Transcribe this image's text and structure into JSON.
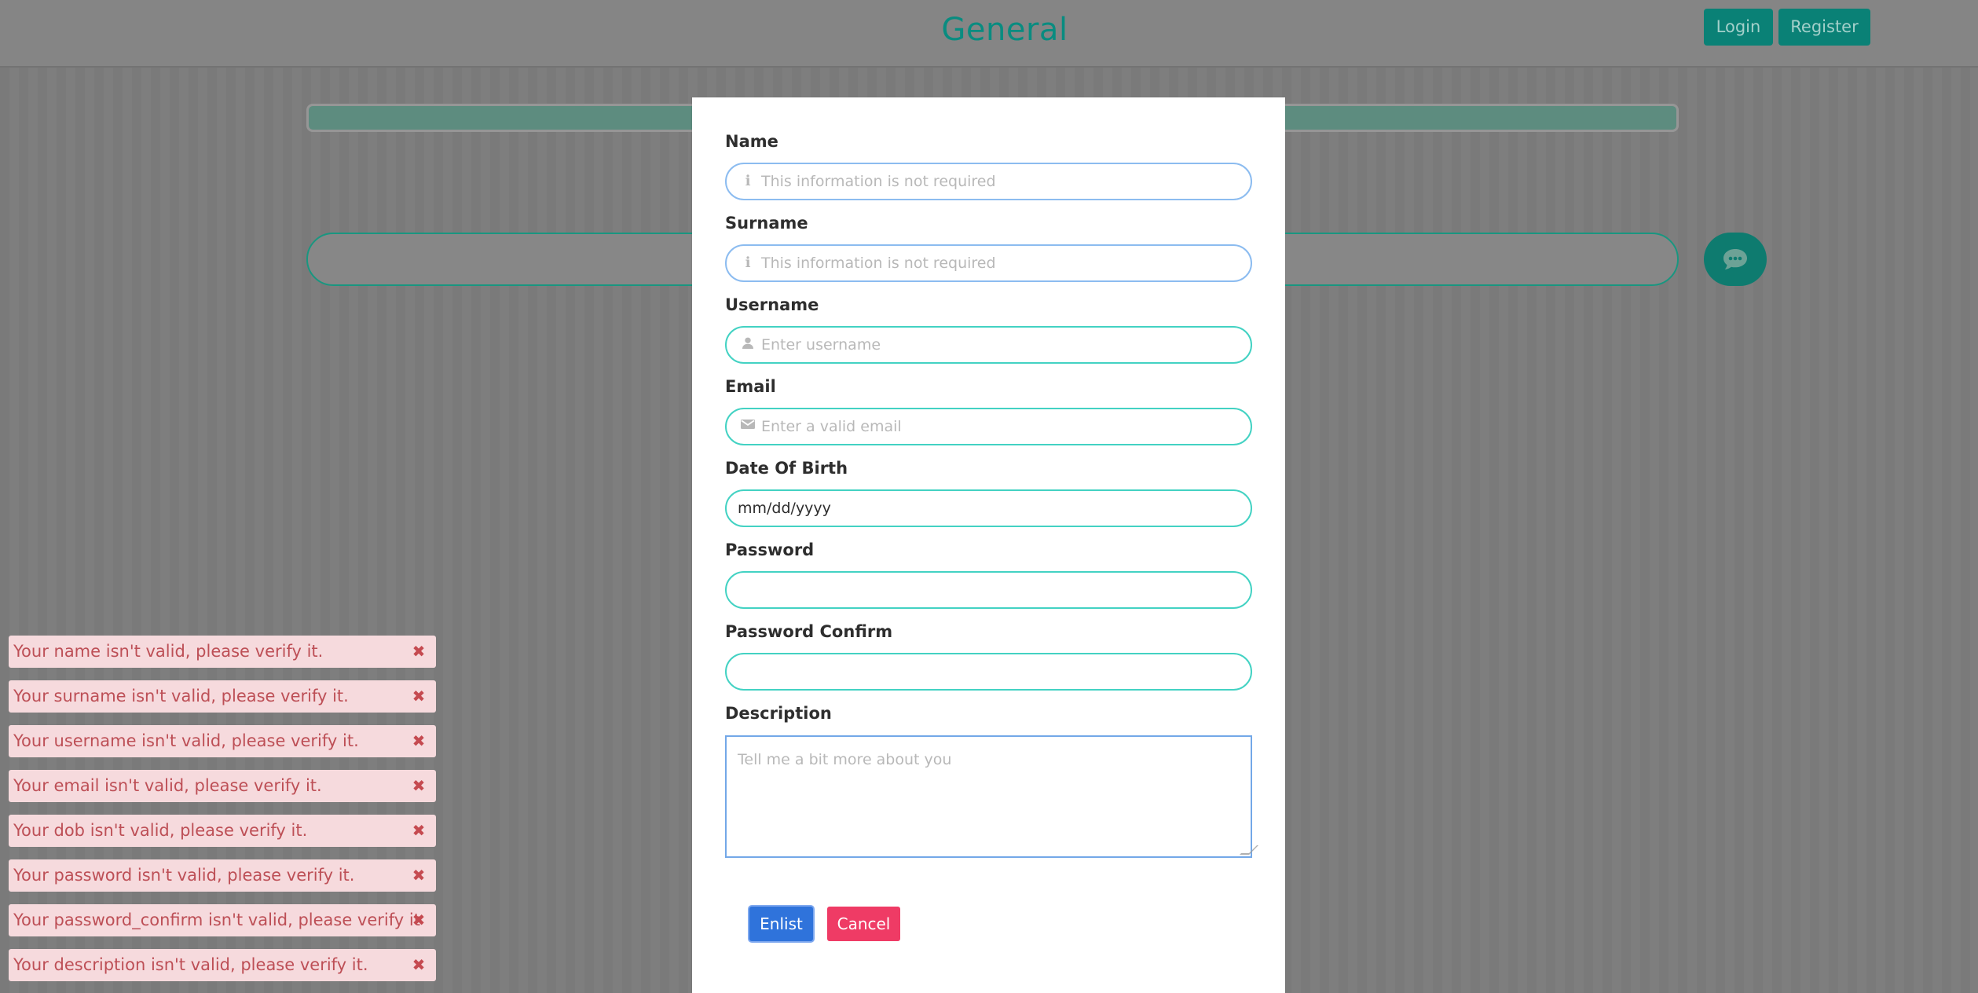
{
  "header": {
    "title": "General",
    "login_label": "Login",
    "register_label": "Register"
  },
  "background": {
    "progress_fraction": 1,
    "chat_icon": "chat-bubble-icon",
    "accent_color": "#0b8479"
  },
  "form": {
    "name": {
      "label": "Name",
      "placeholder": "This information is not required",
      "icon": "info-icon"
    },
    "surname": {
      "label": "Surname",
      "placeholder": "This information is not required",
      "icon": "info-icon"
    },
    "username": {
      "label": "Username",
      "placeholder": "Enter username",
      "icon": "user-icon"
    },
    "email": {
      "label": "Email",
      "placeholder": "Enter a valid email",
      "icon": "envelope-icon"
    },
    "dob": {
      "label": "Date Of Birth",
      "value": "mm/dd/yyyy"
    },
    "password": {
      "label": "Password"
    },
    "password_confirm": {
      "label": "Password Confirm"
    },
    "description": {
      "label": "Description",
      "placeholder": "Tell me a bit more about you"
    },
    "enlist_label": "Enlist",
    "cancel_label": "Cancel",
    "colors": {
      "field_border": "#43d2c3",
      "focus_border": "#8cbcf0",
      "enlist": "#2f73db",
      "cancel": "#ef3b65"
    }
  },
  "toasts": [
    "Your name isn't valid, please verify it.",
    "Your surname isn't valid, please verify it.",
    "Your username isn't valid, please verify it.",
    "Your email isn't valid, please verify it.",
    "Your dob isn't valid, please verify it.",
    "Your password isn't valid, please verify it.",
    "Your password_confirm isn't valid, please verify it.",
    "Your description isn't valid, please verify it."
  ],
  "toast_close_icon": "close-icon",
  "toast_colors": {
    "background": "#f6dadd",
    "text": "#bd4f56"
  }
}
